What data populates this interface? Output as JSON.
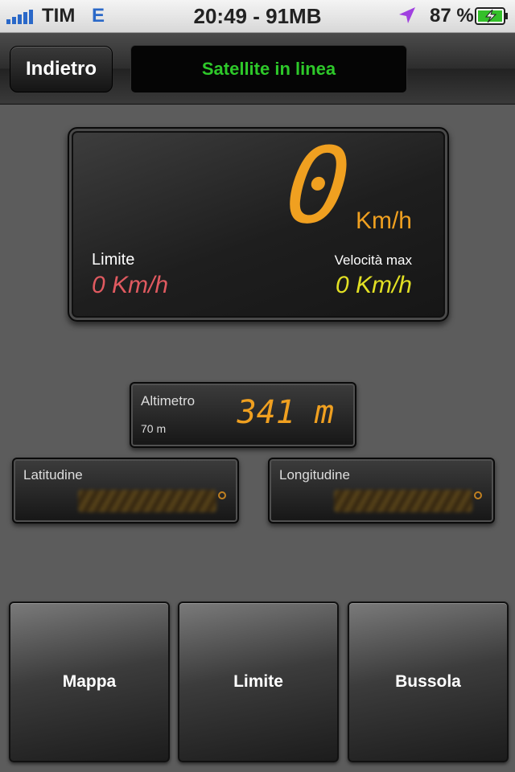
{
  "status_bar": {
    "carrier": "TIM",
    "network": "E",
    "clock": "20:49 - 91MB",
    "battery": "87 %",
    "icons": {
      "signal": "signal-bars-icon",
      "location": "location-arrow-icon",
      "battery": "battery-charging-icon"
    },
    "colors": {
      "network": "#2a68c8",
      "location": "#a040e0",
      "battery_fill": "#34c02a"
    }
  },
  "nav": {
    "back_label": "Indietro",
    "status": "Satellite in linea"
  },
  "speedometer": {
    "speed": "0",
    "unit": "Km/h",
    "limit_label": "Limite",
    "limit_value": "0 Km/h",
    "max_label": "Velocità max",
    "max_value": "0 Km/h"
  },
  "altimeter": {
    "label": "Altimetro",
    "accuracy": "70 m",
    "value": "341 m"
  },
  "coordinates": {
    "latitude_label": "Latitudine",
    "longitude_label": "Longitudine"
  },
  "tiles": {
    "map": "Mappa",
    "limit": "Limite",
    "compass": "Bussola"
  },
  "colors": {
    "speed": "#f0a020",
    "limit": "#e05a60",
    "max_speed": "#e2e024",
    "status_text": "#2ec82a"
  }
}
